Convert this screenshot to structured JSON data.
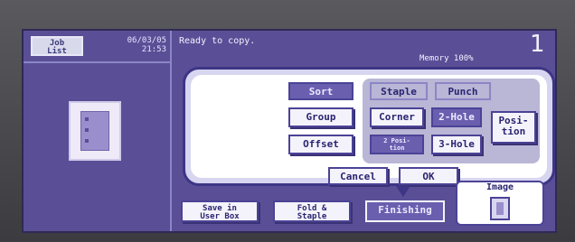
{
  "header": {
    "job_list_label": "Job\nList",
    "datetime": "06/03/05\n21:53",
    "status": "Ready to copy.",
    "memory": "Memory  100%",
    "copy_count": "1"
  },
  "finishing_dialog": {
    "sort_label": "Sort",
    "group_label": "Group",
    "offset_label": "Offset",
    "staple_label": "Staple",
    "punch_label": "Punch",
    "corner_label": "Corner",
    "two_hole_label": "2-Hole",
    "two_position_label": "2 Posi-\ntion",
    "three_hole_label": "3-Hole",
    "position_label": "Posi-\ntion",
    "cancel_label": "Cancel",
    "ok_label": "OK"
  },
  "bottom_bar": {
    "save_label": "Save in\nUser Box",
    "fold_label": "Fold &\nStaple",
    "finishing_label": "Finishing",
    "image_label": "Image"
  },
  "colors": {
    "screen": "#5a4f96",
    "accent": "#6a5fae",
    "border": "#3d3585"
  },
  "icons": {
    "preview": "page-preview-icon",
    "image": "image-preview-icon"
  }
}
